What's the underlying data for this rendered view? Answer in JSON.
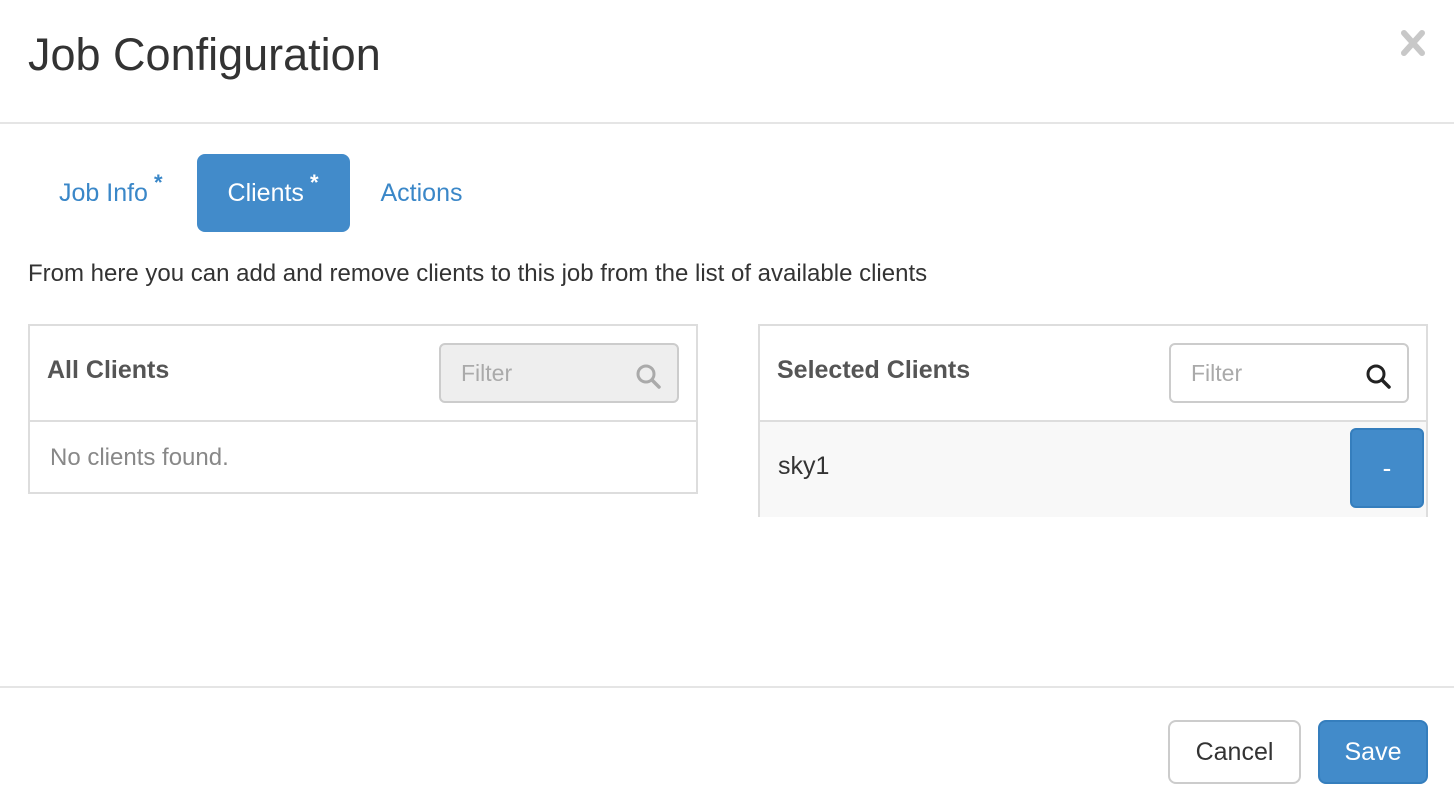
{
  "modal": {
    "title": "Job Configuration",
    "close_icon": "close-icon"
  },
  "tabs": [
    {
      "label": "Job Info",
      "required_marker": "*",
      "active": false
    },
    {
      "label": "Clients",
      "required_marker": "*",
      "active": true
    },
    {
      "label": "Actions",
      "required_marker": "",
      "active": false
    }
  ],
  "description": "From here you can add and remove clients to this job from the list of available clients",
  "all_clients": {
    "title": "All Clients",
    "filter_placeholder": "Filter",
    "filter_value": "",
    "filter_disabled": true,
    "search_icon": "search-icon",
    "empty_message": "No clients found."
  },
  "selected_clients": {
    "title": "Selected Clients",
    "filter_placeholder": "Filter",
    "filter_value": "",
    "search_icon": "search-icon",
    "items": [
      {
        "name": "sky1",
        "remove_label": "-"
      }
    ]
  },
  "footer": {
    "cancel_label": "Cancel",
    "save_label": "Save"
  },
  "colors": {
    "accent": "#428bca",
    "link": "#3a87c8",
    "border": "#dddddd"
  }
}
